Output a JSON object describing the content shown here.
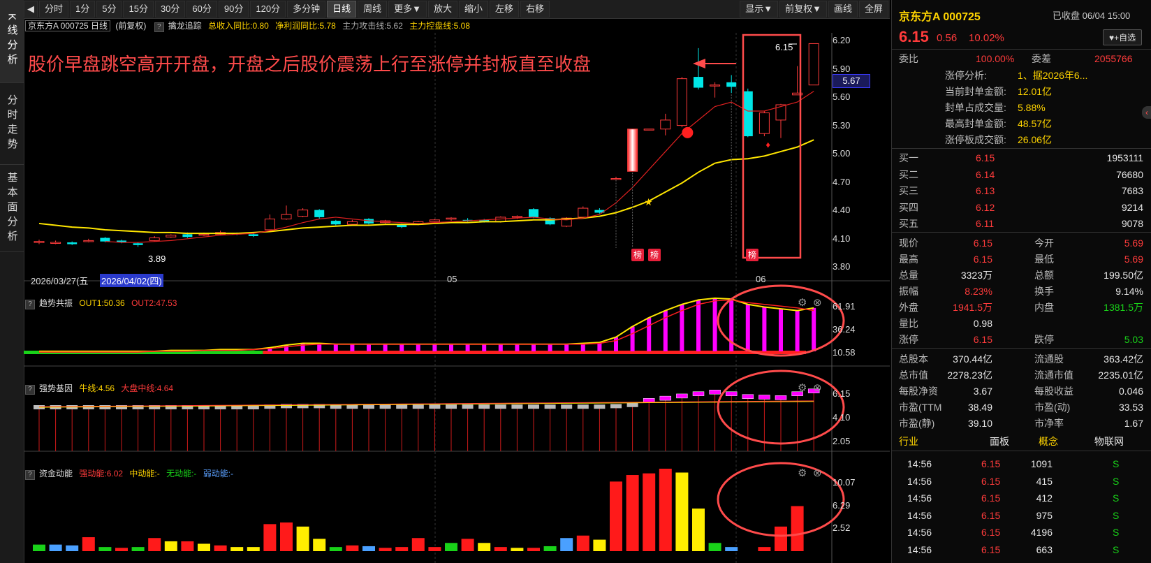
{
  "left_tabs": [
    "K线分析",
    "分时走势",
    "基本面分析"
  ],
  "toolbar": {
    "nav_icon": "back-icon",
    "periods": [
      "分时",
      "1分",
      "5分",
      "15分",
      "30分",
      "60分",
      "90分",
      "120分",
      "多分钟",
      "日线",
      "周线",
      "更多▼",
      "放大",
      "缩小",
      "左移",
      "右移"
    ],
    "active_period": "日线",
    "right_buttons": [
      "显示▼",
      "前复权▼",
      "画线",
      "全屏"
    ]
  },
  "info_line": {
    "stock": "京东方A 000725 日线",
    "adj": "(前复权)",
    "indicator_name": "擒龙追踪",
    "income_yoy": "总收入同比:0.80",
    "profit_yoy": "净利润同比:5.78",
    "attack_line": "主力攻击线:5.62",
    "control_line": "主力控盘线:5.08"
  },
  "main_chart": {
    "annotation": "股价早盘跳空高开开盘，开盘之后股价震荡上行至涨停并封板直至收盘",
    "price_ticks": [
      "6.20",
      "5.90",
      "5.60",
      "5.30",
      "5.00",
      "4.70",
      "4.40",
      "4.10",
      "3.80"
    ],
    "current_price_tag": "5.67",
    "high_label": "6.15",
    "low_label": "3.89",
    "date_left": "2026/03/27(五",
    "date_cursor": "2026/04/02(四)",
    "month_labels": [
      "05",
      "06"
    ],
    "badge_text": "榜",
    "colors": {
      "up": "#ff3b3b",
      "down": "#00e6e6",
      "ma_yellow": "#ffe600",
      "ma_red": "#e02020",
      "highlight": "#ff4b4b"
    }
  },
  "panel1": {
    "title": "趋势共振",
    "out1": "OUT1:50.36",
    "out2": "OUT2:47.53",
    "ticks": [
      "61.91",
      "36.24",
      "10.58"
    ]
  },
  "panel2": {
    "title": "强势基因",
    "bull": "牛线:4.56",
    "market": "大盘中线:4.64",
    "ticks": [
      "6.15",
      "4.10",
      "2.05"
    ]
  },
  "panel3": {
    "title": "资金动能",
    "strong": "强动能:6.02",
    "mid": "中动能:-",
    "none": "无动能:-",
    "weak": "弱动能:-",
    "ticks": [
      "10.07",
      "6.29",
      "2.52"
    ]
  },
  "right_panel": {
    "title": "京东方A 000725",
    "status": "已收盘 06/04 15:00",
    "price": "6.15",
    "change": "0.56",
    "change_pct": "10.02%",
    "add_button": "+自选",
    "weibi_label": "委比",
    "weibi": "100.00%",
    "weicha_label": "委差",
    "weicha": "2055766",
    "limit_info": [
      {
        "label": "涨停分析:",
        "value": "1、据2026年6..."
      },
      {
        "label": "当前封单金额:",
        "value": "12.01亿"
      },
      {
        "label": "封单占成交量:",
        "value": "5.88%"
      },
      {
        "label": "最高封单金额:",
        "value": "48.57亿"
      },
      {
        "label": "涨停板成交额:",
        "value": "26.06亿"
      }
    ],
    "bids": [
      {
        "label": "买一",
        "price": "6.15",
        "vol": "1953111"
      },
      {
        "label": "买二",
        "price": "6.14",
        "vol": "76680"
      },
      {
        "label": "买三",
        "price": "6.13",
        "vol": "7683"
      },
      {
        "label": "买四",
        "price": "6.12",
        "vol": "9214"
      },
      {
        "label": "买五",
        "price": "6.11",
        "vol": "9078"
      }
    ],
    "stats": [
      {
        "l1": "现价",
        "v1": "6.15",
        "c1": "red",
        "l2": "今开",
        "v2": "5.69",
        "c2": "red"
      },
      {
        "l1": "最高",
        "v1": "6.15",
        "c1": "red",
        "l2": "最低",
        "v2": "5.69",
        "c2": "red"
      },
      {
        "l1": "总量",
        "v1": "3323万",
        "c1": "white",
        "l2": "总额",
        "v2": "199.50亿",
        "c2": "white"
      },
      {
        "l1": "振幅",
        "v1": "8.23%",
        "c1": "red",
        "l2": "换手",
        "v2": "9.14%",
        "c2": "white"
      },
      {
        "l1": "外盘",
        "v1": "1941.5万",
        "c1": "red",
        "l2": "内盘",
        "v2": "1381.5万",
        "c2": "green"
      },
      {
        "l1": "量比",
        "v1": "0.98",
        "c1": "white",
        "l2": "",
        "v2": "",
        "c2": "white"
      },
      {
        "l1": "涨停",
        "v1": "6.15",
        "c1": "red",
        "l2": "跌停",
        "v2": "5.03",
        "c2": "green"
      }
    ],
    "fundamentals": [
      {
        "l1": "总股本",
        "v1": "370.44亿",
        "l2": "流通股",
        "v2": "363.42亿"
      },
      {
        "l1": "总市值",
        "v1": "2278.23亿",
        "l2": "流通市值",
        "v2": "2235.01亿"
      },
      {
        "l1": "每股净资",
        "v1": "3.67",
        "l2": "每股收益",
        "v2": "0.046"
      },
      {
        "l1": "市盈(TTM",
        "v1": "38.49",
        "l2": "市盈(动)",
        "v2": "33.53"
      },
      {
        "l1": "市盈(静)",
        "v1": "39.10",
        "l2": "市净率",
        "v2": "1.67"
      }
    ],
    "tags": [
      "行业",
      "面板",
      "概念",
      "物联网"
    ],
    "ticks": [
      {
        "time": "14:56",
        "price": "6.15",
        "vol": "1091",
        "dir": "S"
      },
      {
        "time": "14:56",
        "price": "6.15",
        "vol": "415",
        "dir": "S"
      },
      {
        "time": "14:56",
        "price": "6.15",
        "vol": "412",
        "dir": "S"
      },
      {
        "time": "14:56",
        "price": "6.15",
        "vol": "975",
        "dir": "S"
      },
      {
        "time": "14:56",
        "price": "6.15",
        "vol": "4196",
        "dir": "S"
      },
      {
        "time": "14:56",
        "price": "6.15",
        "vol": "663",
        "dir": "S"
      }
    ]
  },
  "candles": [
    {
      "o": 3.94,
      "c": 3.95,
      "h": 3.97,
      "l": 3.92
    },
    {
      "o": 3.93,
      "c": 3.94,
      "h": 3.96,
      "l": 3.92
    },
    {
      "o": 3.94,
      "c": 3.92,
      "h": 3.95,
      "l": 3.91
    },
    {
      "o": 3.95,
      "c": 3.96,
      "h": 3.98,
      "l": 3.94
    },
    {
      "o": 3.99,
      "c": 3.95,
      "h": 4.0,
      "l": 3.94
    },
    {
      "o": 3.96,
      "c": 3.94,
      "h": 3.97,
      "l": 3.93
    },
    {
      "o": 3.93,
      "c": 3.91,
      "h": 3.94,
      "l": 3.89
    },
    {
      "o": 3.96,
      "c": 3.99,
      "h": 4.01,
      "l": 3.95
    },
    {
      "o": 4.0,
      "c": 4.02,
      "h": 4.03,
      "l": 3.99
    },
    {
      "o": 4.03,
      "c": 4.0,
      "h": 4.05,
      "l": 3.99
    },
    {
      "o": 4.02,
      "c": 4.03,
      "h": 4.05,
      "l": 4.01
    },
    {
      "o": 4.03,
      "c": 4.05,
      "h": 4.07,
      "l": 4.02
    },
    {
      "o": 4.04,
      "c": 4.03,
      "h": 4.05,
      "l": 4.02
    },
    {
      "o": 4.03,
      "c": 4.01,
      "h": 4.04,
      "l": 4.0
    },
    {
      "o": 4.08,
      "c": 4.2,
      "h": 4.25,
      "l": 4.07
    },
    {
      "o": 4.2,
      "c": 4.25,
      "h": 4.35,
      "l": 4.19
    },
    {
      "o": 4.23,
      "c": 4.3,
      "h": 4.32,
      "l": 4.22
    },
    {
      "o": 4.3,
      "c": 4.22,
      "h": 4.31,
      "l": 4.2
    },
    {
      "o": 4.18,
      "c": 4.14,
      "h": 4.19,
      "l": 4.13
    },
    {
      "o": 4.14,
      "c": 4.17,
      "h": 4.19,
      "l": 4.13
    },
    {
      "o": 4.2,
      "c": 4.15,
      "h": 4.21,
      "l": 4.14
    },
    {
      "o": 4.16,
      "c": 4.18,
      "h": 4.19,
      "l": 4.15
    },
    {
      "o": 4.14,
      "c": 4.11,
      "h": 4.15,
      "l": 4.1
    },
    {
      "o": 4.14,
      "c": 4.17,
      "h": 4.18,
      "l": 4.13
    },
    {
      "o": 4.17,
      "c": 4.19,
      "h": 4.2,
      "l": 4.16
    },
    {
      "o": 4.2,
      "c": 4.21,
      "h": 4.22,
      "l": 4.18
    },
    {
      "o": 4.19,
      "c": 4.18,
      "h": 4.21,
      "l": 4.17
    },
    {
      "o": 4.19,
      "c": 4.17,
      "h": 4.2,
      "l": 4.16
    },
    {
      "o": 4.17,
      "c": 4.22,
      "h": 4.23,
      "l": 4.16
    },
    {
      "o": 4.22,
      "c": 4.23,
      "h": 4.24,
      "l": 4.2
    },
    {
      "o": 4.31,
      "c": 4.22,
      "h": 4.32,
      "l": 4.21
    },
    {
      "o": 4.21,
      "c": 4.14,
      "h": 4.22,
      "l": 4.13
    },
    {
      "o": 4.12,
      "c": 4.21,
      "h": 4.22,
      "l": 4.11
    },
    {
      "o": 4.22,
      "c": 4.32,
      "h": 4.34,
      "l": 4.21
    },
    {
      "o": 4.3,
      "c": 4.27,
      "h": 4.32,
      "l": 4.26
    },
    {
      "o": 4.65,
      "c": 4.65,
      "h": 4.67,
      "l": 4.65
    },
    {
      "o": 4.73,
      "c": 5.2,
      "h": 5.2,
      "l": 4.73
    },
    {
      "o": 5.2,
      "c": 5.2,
      "h": 5.2,
      "l": 5.2
    },
    {
      "o": 5.2,
      "c": 5.3,
      "h": 5.37,
      "l": 5.13
    },
    {
      "o": 5.24,
      "c": 5.76,
      "h": 5.78,
      "l": 5.22
    },
    {
      "o": 5.78,
      "c": 5.66,
      "h": 6.1,
      "l": 5.64
    },
    {
      "o": 5.69,
      "c": 5.69,
      "h": 5.72,
      "l": 5.55
    },
    {
      "o": 5.72,
      "c": 5.67,
      "h": 5.8,
      "l": 5.6
    },
    {
      "o": 5.62,
      "c": 5.12,
      "h": 5.65,
      "l": 5.11
    },
    {
      "o": 5.15,
      "c": 5.38,
      "h": 5.4,
      "l": 5.12
    },
    {
      "o": 5.3,
      "c": 5.47,
      "h": 5.48,
      "l": 5.1
    },
    {
      "o": 5.58,
      "c": 5.6,
      "h": 5.9,
      "l": 5.58
    },
    {
      "o": 5.69,
      "c": 6.15,
      "h": 6.15,
      "l": 5.69
    }
  ],
  "ma_yellow": [
    4.15,
    4.13,
    4.11,
    4.1,
    4.08,
    4.07,
    4.06,
    4.05,
    4.05,
    4.04,
    4.04,
    4.04,
    4.04,
    4.05,
    4.06,
    4.08,
    4.1,
    4.11,
    4.12,
    4.13,
    4.13,
    4.14,
    4.14,
    4.14,
    4.15,
    4.16,
    4.16,
    4.17,
    4.17,
    4.18,
    4.19,
    4.19,
    4.2,
    4.21,
    4.23,
    4.27,
    4.33,
    4.4,
    4.5,
    4.6,
    4.72,
    4.82,
    4.86,
    4.87,
    4.9,
    4.95,
    5.0,
    5.08
  ],
  "ma_red": [
    null,
    null,
    null,
    null,
    3.95,
    3.94,
    3.94,
    3.95,
    3.96,
    3.98,
    4.0,
    4.02,
    4.03,
    4.04,
    4.07,
    4.11,
    4.16,
    4.2,
    4.22,
    4.2,
    4.18,
    4.17,
    4.16,
    4.15,
    4.16,
    4.17,
    4.18,
    4.19,
    4.2,
    4.21,
    4.22,
    4.2,
    4.19,
    4.21,
    4.25,
    4.38,
    4.55,
    4.75,
    4.95,
    5.15,
    5.3,
    5.45,
    5.5,
    5.4,
    5.4,
    5.45,
    5.5,
    5.62
  ],
  "p1_line1": [
    2,
    2,
    2,
    2,
    2,
    2,
    2,
    2,
    3,
    3,
    3,
    4,
    4,
    4,
    6,
    9,
    11,
    11,
    10,
    10,
    10,
    10,
    10,
    10,
    10,
    10,
    10,
    10,
    10,
    10,
    10,
    10,
    10,
    11,
    12,
    18,
    30,
    40,
    48,
    55,
    60,
    62,
    61,
    55,
    52,
    50,
    48,
    51
  ],
  "p1_line2": [
    1,
    1,
    1,
    1,
    1,
    1,
    1,
    2,
    2,
    2,
    3,
    3,
    3,
    4,
    5,
    7,
    9,
    10,
    10,
    10,
    10,
    10,
    10,
    10,
    10,
    10,
    10,
    10,
    10,
    10,
    10,
    10,
    10,
    10,
    11,
    14,
    22,
    31,
    40,
    48,
    55,
    59,
    60,
    57,
    55,
    53,
    51,
    48
  ],
  "p2_bars": [
    4.1,
    4.1,
    4.1,
    4.1,
    4.1,
    4.1,
    4.1,
    4.1,
    4.1,
    4.1,
    4.1,
    4.1,
    4.1,
    4.1,
    4.15,
    4.2,
    4.2,
    4.2,
    4.15,
    4.15,
    4.15,
    4.15,
    4.15,
    4.15,
    4.15,
    4.15,
    4.15,
    4.15,
    4.15,
    4.15,
    4.15,
    4.15,
    4.15,
    4.15,
    4.15,
    4.2,
    4.3,
    4.7,
    4.9,
    5.1,
    5.3,
    5.45,
    5.3,
    5.05,
    5.0,
    4.95,
    5.3,
    5.55
  ],
  "p3_bars": [
    {
      "v": 0.8,
      "c": "g"
    },
    {
      "v": 0.8,
      "c": "b"
    },
    {
      "v": 0.7,
      "c": "b"
    },
    {
      "v": 1.7,
      "c": "r"
    },
    {
      "v": 0.5,
      "c": "g"
    },
    {
      "v": 0.4,
      "c": "r"
    },
    {
      "v": 0.5,
      "c": "g"
    },
    {
      "v": 1.6,
      "c": "r"
    },
    {
      "v": 1.2,
      "c": "y"
    },
    {
      "v": 1.2,
      "c": "r"
    },
    {
      "v": 0.9,
      "c": "y"
    },
    {
      "v": 0.7,
      "c": "r"
    },
    {
      "v": 0.5,
      "c": "y"
    },
    {
      "v": 0.5,
      "c": "y"
    },
    {
      "v": 3.3,
      "c": "r"
    },
    {
      "v": 3.5,
      "c": "r"
    },
    {
      "v": 3.0,
      "c": "y"
    },
    {
      "v": 1.5,
      "c": "y"
    },
    {
      "v": 0.5,
      "c": "g"
    },
    {
      "v": 0.7,
      "c": "r"
    },
    {
      "v": 0.6,
      "c": "b"
    },
    {
      "v": 0.4,
      "c": "r"
    },
    {
      "v": 0.5,
      "c": "r"
    },
    {
      "v": 1.6,
      "c": "r"
    },
    {
      "v": 0.5,
      "c": "r"
    },
    {
      "v": 1.0,
      "c": "g"
    },
    {
      "v": 1.5,
      "c": "r"
    },
    {
      "v": 1.0,
      "c": "y"
    },
    {
      "v": 0.5,
      "c": "r"
    },
    {
      "v": 0.4,
      "c": "y"
    },
    {
      "v": 0.4,
      "c": "r"
    },
    {
      "v": 0.6,
      "c": "g"
    },
    {
      "v": 1.6,
      "c": "b"
    },
    {
      "v": 1.9,
      "c": "r"
    },
    {
      "v": 1.4,
      "c": "y"
    },
    {
      "v": 8.5,
      "c": "r"
    },
    {
      "v": 9.3,
      "c": "r"
    },
    {
      "v": 9.5,
      "c": "r"
    },
    {
      "v": 10.07,
      "c": "r"
    },
    {
      "v": 9.6,
      "c": "y"
    },
    {
      "v": 5.2,
      "c": "y"
    },
    {
      "v": 1.0,
      "c": "g"
    },
    {
      "v": 0.5,
      "c": "b"
    },
    {
      "v": 0,
      "c": "r"
    },
    {
      "v": 0.5,
      "c": "r"
    },
    {
      "v": 3.0,
      "c": "r"
    },
    {
      "v": 5.5,
      "c": "r"
    }
  ]
}
